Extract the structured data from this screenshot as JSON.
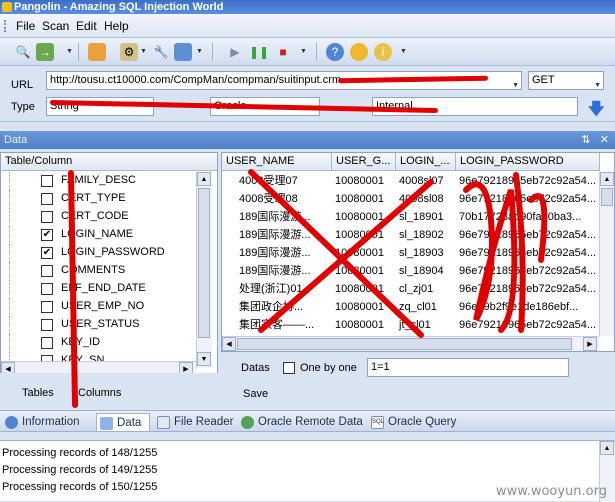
{
  "window": {
    "title": "Pangolin - Amazing SQL Injection World"
  },
  "menu": [
    "File",
    "Scan",
    "Edit",
    "Help"
  ],
  "url_panel": {
    "url_label": "URL",
    "url_value": "http://tousu.ct10000.com/CompMan/compman/suitinput.crm...",
    "method_value": "GET",
    "type_label": "Type",
    "type_value": "String",
    "db_value": "Oracle",
    "mode_value": "Internal"
  },
  "data_panel": {
    "header": "Data",
    "tree_header": "Table/Column",
    "columns": [
      {
        "name": "FAMILY_DESC",
        "checked": false
      },
      {
        "name": "CERT_TYPE",
        "checked": false
      },
      {
        "name": "CERT_CODE",
        "checked": false
      },
      {
        "name": "LOGIN_NAME",
        "checked": true
      },
      {
        "name": "LOGIN_PASSWORD",
        "checked": true
      },
      {
        "name": "COMMENTS",
        "checked": false
      },
      {
        "name": "EFF_END_DATE",
        "checked": false
      },
      {
        "name": "USER_EMP_NO",
        "checked": false
      },
      {
        "name": "USER_STATUS",
        "checked": false
      },
      {
        "name": "KEY_ID",
        "checked": false
      },
      {
        "name": "KEY_SN",
        "checked": false
      }
    ],
    "tables_label": "Tables",
    "columns_label": "Columns"
  },
  "grid": {
    "headers": [
      "USER_NAME",
      "USER_G...",
      "LOGIN_...",
      "LOGIN_PASSWORD"
    ],
    "rows": [
      [
        "4008受理07",
        "10080001",
        "4008sl07",
        "96e79218965eb72c92a54..."
      ],
      [
        "4008受理08",
        "10080001",
        "4008sl08",
        "96e79218965eb72c92a54..."
      ],
      [
        "189国际漫游...",
        "10080001",
        "sl_18901",
        "70b17728ad90fae0ba3..."
      ],
      [
        "189国际漫游...",
        "10080001",
        "sl_18902",
        "96e79218965eb72c92a54..."
      ],
      [
        "189国际漫游...",
        "10080001",
        "sl_18903",
        "96e79218965eb72c92a54..."
      ],
      [
        "189国际漫游...",
        "10080001",
        "sl_18904",
        "96e79218965eb72c92a54..."
      ],
      [
        "处理(浙江)01",
        "10080001",
        "cl_zj01",
        "96e79218965eb72c92a54..."
      ],
      [
        "集团政企协...",
        "10080001",
        "zq_cl01",
        "96e79b2f9e1de186ebf..."
      ],
      [
        "集团家客——...",
        "10080001",
        "jt_cl01",
        "96e79218965eb72c92a54..."
      ]
    ],
    "datas_label": "Datas",
    "one_by_one_label": "One by one",
    "condition_value": "1=1",
    "save_label": "Save"
  },
  "tabs": [
    "Information",
    "Data",
    "File Reader",
    "Oracle Remote Data",
    "Oracle Query"
  ],
  "active_tab": "Data",
  "log": [
    "Processing records of 148/1255",
    "Processing records of 149/1255",
    "Processing records of 150/1255"
  ],
  "watermark": "www.wooyun.org",
  "colors": {
    "redaction": "#e00000",
    "title_blue": "#3a6fc9"
  }
}
